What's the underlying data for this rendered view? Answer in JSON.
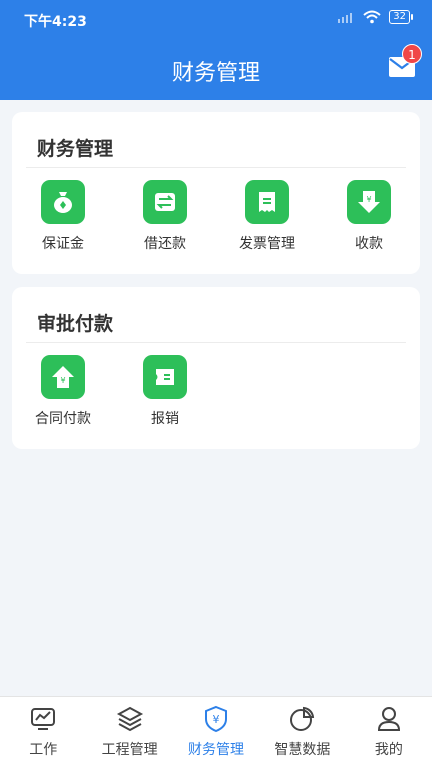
{
  "status": {
    "time": "下午4:23",
    "battery": "32"
  },
  "header": {
    "title": "财务管理",
    "badge": "1"
  },
  "sections": [
    {
      "title": "财务管理",
      "items": [
        {
          "label": "保证金",
          "icon": "money-bag-icon"
        },
        {
          "label": "借还款",
          "icon": "exchange-icon"
        },
        {
          "label": "发票管理",
          "icon": "invoice-icon"
        },
        {
          "label": "收款",
          "icon": "receive-payment-icon"
        }
      ]
    },
    {
      "title": "审批付款",
      "items": [
        {
          "label": "合同付款",
          "icon": "contract-payment-icon"
        },
        {
          "label": "报销",
          "icon": "reimburse-icon"
        }
      ]
    }
  ],
  "tabs": [
    {
      "label": "工作",
      "icon": "chart-monitor-icon"
    },
    {
      "label": "工程管理",
      "icon": "layers-icon"
    },
    {
      "label": "财务管理",
      "icon": "yuan-shield-icon",
      "active": true
    },
    {
      "label": "智慧数据",
      "icon": "pie-chart-icon"
    },
    {
      "label": "我的",
      "icon": "user-icon"
    }
  ],
  "colors": {
    "primary": "#2d80e8",
    "tile": "#2dbf59",
    "badge": "#f04747"
  }
}
